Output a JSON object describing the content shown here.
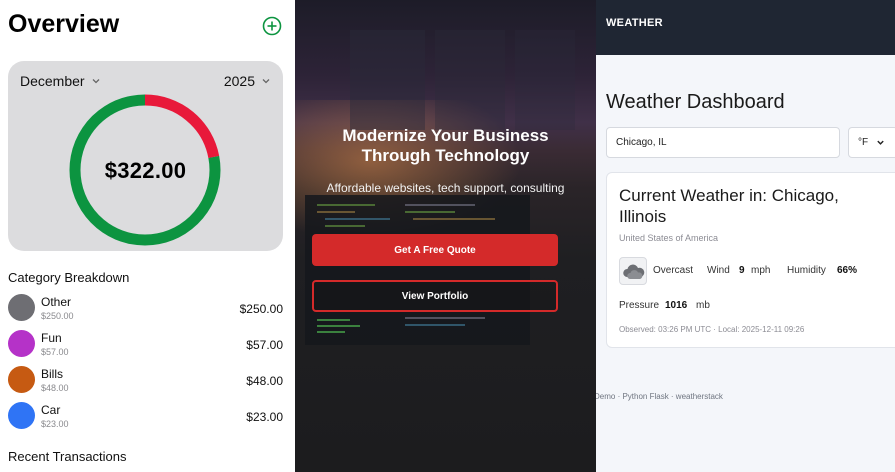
{
  "overview": {
    "title": "Overview",
    "month": "December",
    "year": "2025",
    "total": "$322.00",
    "breakdown_title": "Category Breakdown",
    "categories": [
      {
        "name": "Other",
        "sub": "$250.00",
        "amount": "$250.00",
        "color": "#6e6e73"
      },
      {
        "name": "Fun",
        "sub": "$57.00",
        "amount": "$57.00",
        "color": "#b532c8"
      },
      {
        "name": "Bills",
        "sub": "$48.00",
        "amount": "$48.00",
        "color": "#c65a12"
      },
      {
        "name": "Car",
        "sub": "$23.00",
        "amount": "$23.00",
        "color": "#2f74f5"
      }
    ],
    "recent_title": "Recent Transactions",
    "donut": {
      "green_fraction": 0.78,
      "red_fraction": 0.22,
      "green": "#0c9440",
      "red": "#e8193a"
    }
  },
  "hero": {
    "headline_line1": "Modernize Your Business",
    "headline_line2": "Through Technology",
    "subhead": "Affordable websites, tech support, consulting",
    "primary_button": "Get A Free Quote",
    "secondary_button": "View Portfolio",
    "accent": "#d42a2a"
  },
  "weather": {
    "brand": "WEATHER",
    "title": "Weather Dashboard",
    "location_value": "Chicago, IL",
    "unit_value": "°F",
    "card_title": "Current Weather in: Chicago, Illinois",
    "country": "United States of America",
    "condition": "Overcast",
    "wind_label": "Wind",
    "wind_value": "9",
    "wind_unit": "mph",
    "humidity_label": "Humidity",
    "humidity_value": "66%",
    "pressure_label": "Pressure",
    "pressure_value": "1016",
    "pressure_unit": "mb",
    "observed": "Observed: 03:26 PM UTC · Local: 2025-12-11 09:26",
    "footer": "Demo · Python Flask · weatherstack"
  }
}
